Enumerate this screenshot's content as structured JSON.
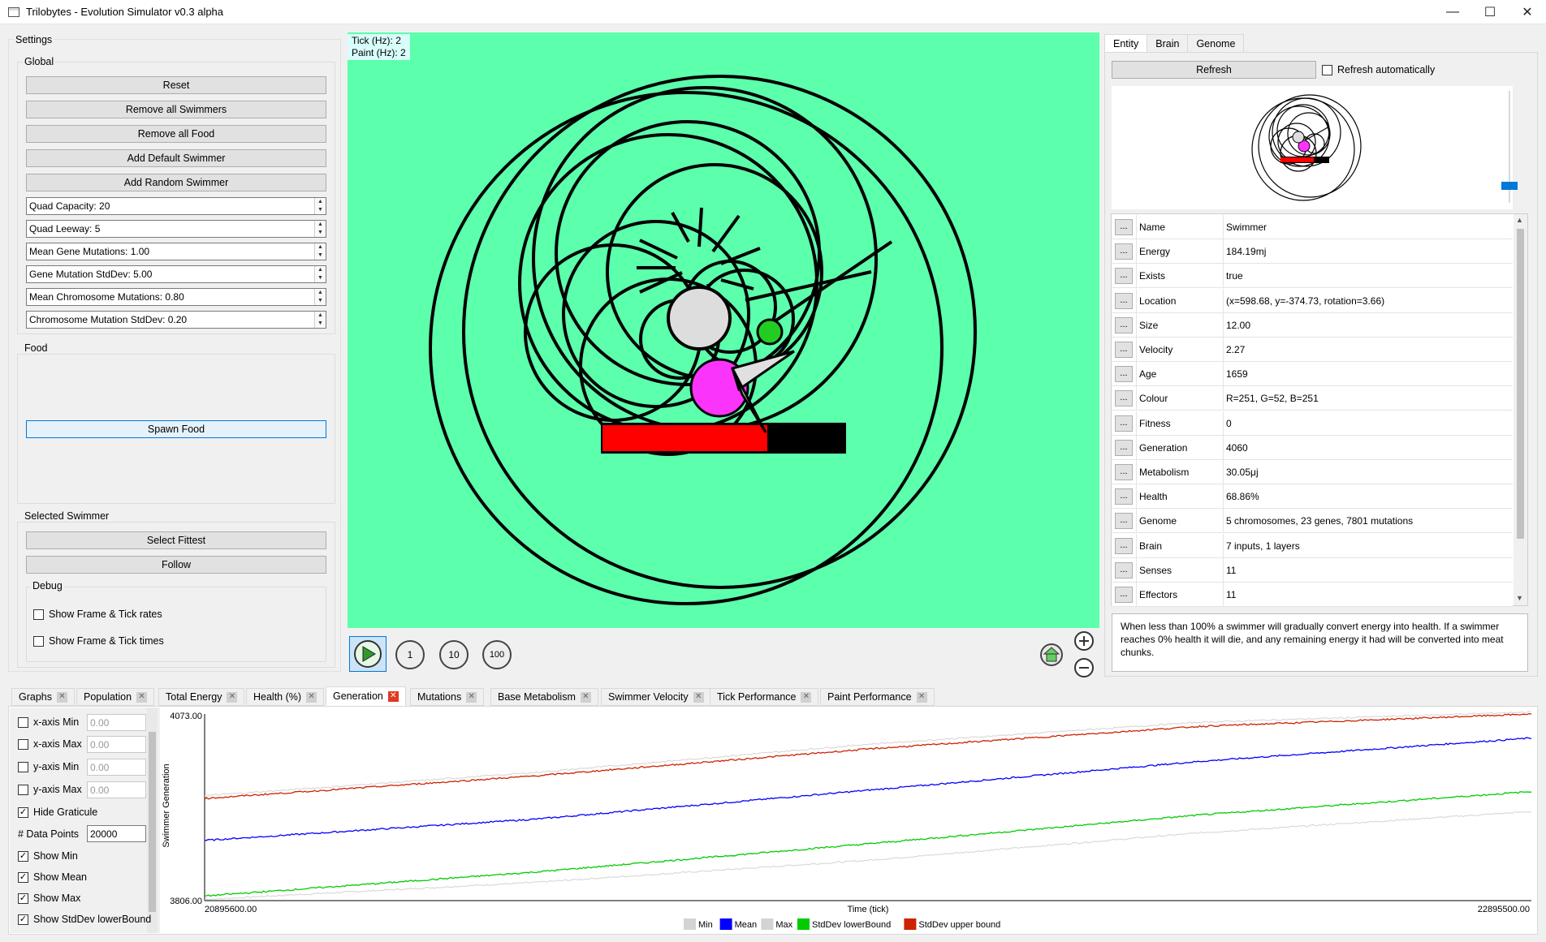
{
  "window": {
    "title": "Trilobytes - Evolution Simulator v0.3 alpha"
  },
  "settings": {
    "title": "Settings",
    "global": {
      "title": "Global",
      "buttons": [
        "Reset",
        "Remove all Swimmers",
        "Remove all Food",
        "Add Default Swimmer",
        "Add Random Swimmer"
      ],
      "spinners": [
        "Quad Capacity: 20",
        "Quad Leeway: 5",
        "Mean Gene Mutations: 1.00",
        "Gene Mutation StdDev: 5.00",
        "Mean Chromosome Mutations: 0.80",
        "Chromosome Mutation StdDev: 0.20"
      ]
    },
    "food": {
      "title": "Food",
      "spawn_label": "Spawn Food"
    },
    "selected": {
      "title": "Selected Swimmer",
      "select_fittest": "Select Fittest",
      "follow": "Follow",
      "debug": {
        "title": "Debug",
        "show_rates": "Show Frame & Tick rates",
        "show_times": "Show Frame & Tick times"
      }
    }
  },
  "sim": {
    "tick_rate": "Tick (Hz): 2",
    "paint_rate": "Paint (Hz): 2",
    "controls": {
      "step1": "1",
      "step10": "10",
      "step100": "100"
    }
  },
  "inspector": {
    "tabs": [
      "Entity",
      "Brain",
      "Genome"
    ],
    "active_tab": "Entity",
    "refresh_label": "Refresh",
    "auto_refresh_label": "Refresh automatically",
    "properties": [
      {
        "name": "Name",
        "value": "Swimmer"
      },
      {
        "name": "Energy",
        "value": "184.19mj"
      },
      {
        "name": "Exists",
        "value": "true"
      },
      {
        "name": "Location",
        "value": "(x=598.68, y=-374.73, rotation=3.66)"
      },
      {
        "name": "Size",
        "value": "12.00"
      },
      {
        "name": "Velocity",
        "value": "2.27"
      },
      {
        "name": "Age",
        "value": "1659"
      },
      {
        "name": "Colour",
        "value": "R=251, G=52, B=251"
      },
      {
        "name": "Fitness",
        "value": "0"
      },
      {
        "name": "Generation",
        "value": "4060"
      },
      {
        "name": "Metabolism",
        "value": "30.05μj"
      },
      {
        "name": "Health",
        "value": "68.86%"
      },
      {
        "name": "Genome",
        "value": "5 chromosomes, 23 genes, 7801 mutations"
      },
      {
        "name": "Brain",
        "value": "7 inputs, 1 layers"
      },
      {
        "name": "Senses",
        "value": "11"
      },
      {
        "name": "Effectors",
        "value": "11"
      }
    ],
    "description": "When less than 100% a swimmer will gradually convert energy into health. If a swimmer reaches 0% health it will die, and any remaining energy it had will be converted into meat chunks."
  },
  "graph_tabs": [
    "Graphs",
    "Population",
    "Total Energy",
    "Health (%)",
    "Generation",
    "Mutations",
    "Base Metabolism",
    "Swimmer Velocity",
    "Tick Performance",
    "Paint Performance"
  ],
  "graph_active": "Generation",
  "graph_options": {
    "x_min": {
      "label": "x-axis Min",
      "value": "0.00",
      "checked": false
    },
    "x_max": {
      "label": "x-axis Max",
      "value": "0.00",
      "checked": false
    },
    "y_min": {
      "label": "y-axis Min",
      "value": "0.00",
      "checked": false
    },
    "y_max": {
      "label": "y-axis Max",
      "value": "0.00",
      "checked": false
    },
    "hide_graticule": {
      "label": "Hide Graticule",
      "checked": true
    },
    "data_points": {
      "label": "# Data Points",
      "value": "20000"
    },
    "show_min": {
      "label": "Show Min",
      "checked": true
    },
    "show_mean": {
      "label": "Show Mean",
      "checked": true
    },
    "show_max": {
      "label": "Show Max",
      "checked": true
    },
    "show_lower": {
      "label": "Show StdDev lowerBound",
      "checked": true
    }
  },
  "chart_data": {
    "type": "line",
    "xlabel": "Time (tick)",
    "ylabel": "Swimmer Generation",
    "x_min_label": "20895600.00",
    "x_max_label": "22895500.00",
    "y_max_label": "4073.00",
    "y_min_label": "3806.00",
    "xlim": [
      20895600,
      22895500
    ],
    "ylim": [
      3806,
      4073
    ],
    "x": [
      20895600,
      21395575,
      21895550,
      22395525,
      22895500
    ],
    "series": [
      {
        "name": "Min",
        "color": "#d3d3d3",
        "values": [
          3803,
          3828,
          3860,
          3900,
          3931
        ]
      },
      {
        "name": "Mean",
        "color": "#0000ff",
        "values": [
          3889,
          3920,
          3962,
          4004,
          4038
        ]
      },
      {
        "name": "Max",
        "color": "#d3d3d3",
        "values": [
          3954,
          3988,
          4029,
          4061,
          4076
        ]
      },
      {
        "name": "StdDev lowerBound",
        "color": "#00cc00",
        "values": [
          3808,
          3843,
          3884,
          3926,
          3960
        ]
      },
      {
        "name": "StdDev upper bound",
        "color": "#cc2200",
        "values": [
          3950,
          3983,
          4022,
          4055,
          4073
        ]
      }
    ],
    "legend": "bottom-center",
    "grid": false
  }
}
